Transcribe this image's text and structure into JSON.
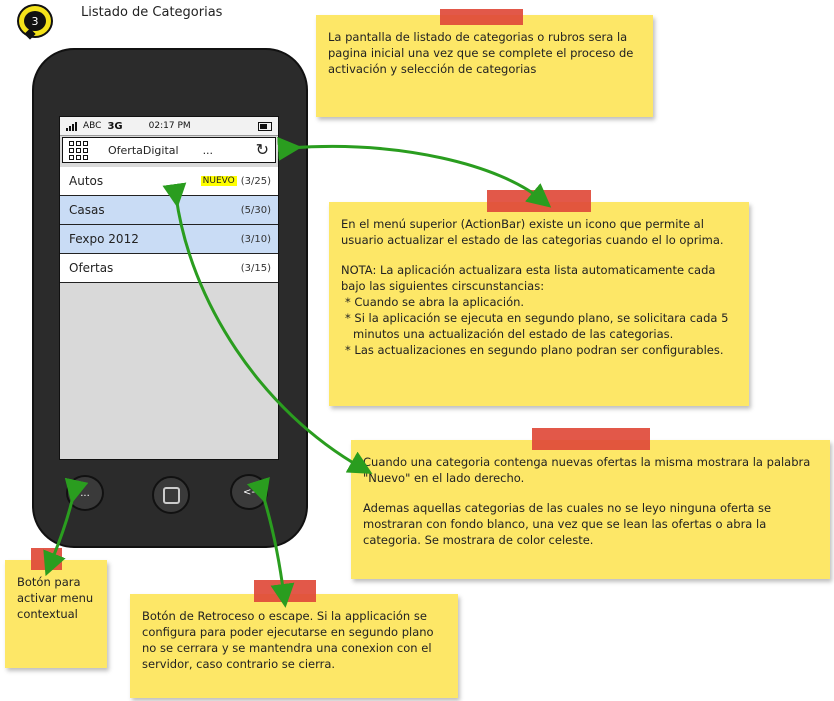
{
  "step_number": "3",
  "page_title": "Listado de Categorias",
  "phone": {
    "status_carrier": "ABC",
    "status_network": "3G",
    "status_time": "02:17 PM",
    "actionbar_title": "OfertaDigital",
    "actionbar_more": "...",
    "categories": [
      {
        "name": "Autos",
        "badge": "NUEVO",
        "count": "(3/25)",
        "state": "unread"
      },
      {
        "name": "Casas",
        "badge": "",
        "count": "(5/30)",
        "state": "read"
      },
      {
        "name": "Fexpo 2012",
        "badge": "",
        "count": "(3/10)",
        "state": "read"
      },
      {
        "name": "Ofertas",
        "badge": "",
        "count": "(3/15)",
        "state": "unread"
      }
    ],
    "menu_button_label": "...",
    "back_button_label": "<-",
    "read_color": "#c9dcf5",
    "new_badge_color": "#ffff00"
  },
  "notes": {
    "home_page": "La pantalla de listado de categorias o rubros sera la pagina inicial una vez que se complete el proceso de activación y selección de categorias",
    "actionbar_intro": "En el menú superior (ActionBar) existe un icono que permite al usuario actualizar el estado de las categorias cuando el lo oprima.",
    "actionbar_nota": "NOTA: La aplicación actualizara esta lista automaticamente cada bajo las siguientes cirscunstancias:",
    "actionbar_items": [
      "Cuando se abra la aplicación.",
      "Si la aplicación se ejecuta en segundo plano, se solicitara cada 5 minutos una actualización del estado de las categorias.",
      "Las actualizaciones en segundo plano podran ser configurables."
    ],
    "nuevo_p1": "Cuando una categoria contenga nuevas ofertas la misma mostrara la palabra \"Nuevo\" en el lado derecho.",
    "nuevo_p2": "Ademas aquellas categorias de las cuales no se leyo ninguna oferta se mostraran con fondo blanco, una vez que se lean las ofertas o abra la categoria. Se mostrara de color celeste.",
    "menu_button": "Botón para activar menu contextual",
    "back_button": "Botón de Retroceso o escape. Si la applicación se configura para poder ejecutarse en segundo plano no se cerrara y se mantendra una conexion con el servidor, caso contrario se cierra."
  },
  "colors": {
    "note_yellow": "#fde767",
    "tape_red": "#e04a3a",
    "arrow_green": "#2a9d1f"
  }
}
